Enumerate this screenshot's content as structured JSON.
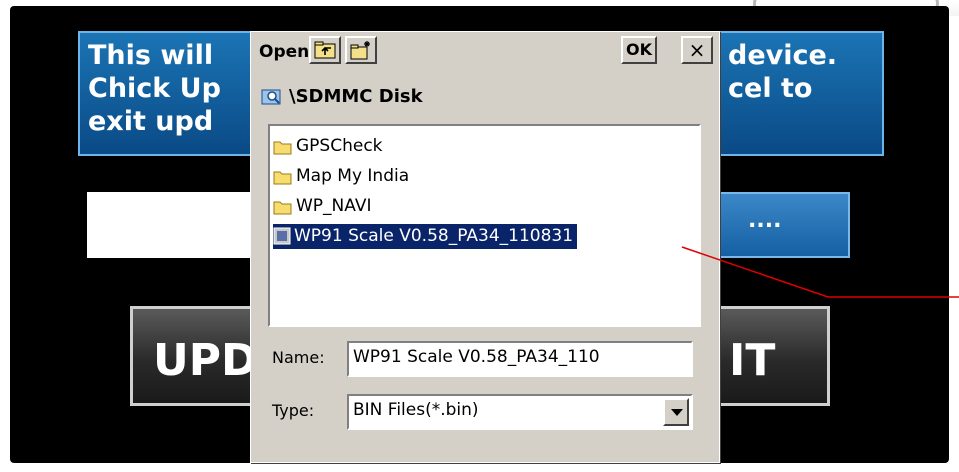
{
  "background_app": {
    "info_line1_left": "This will",
    "info_line1_right": "device.",
    "info_line2_left": "Chick Up",
    "info_line2_right": "cel to",
    "info_line3_left": "exit upd",
    "browse_label": "....",
    "update_label": "UPD/",
    "exit_label": "IT"
  },
  "dialog": {
    "title": "Open",
    "ok_label": "OK",
    "close_label": "×",
    "current_folder": "\\SDMMC Disk",
    "items": [
      {
        "label": "GPSCheck",
        "icon": "folder-icon",
        "selected": false
      },
      {
        "label": "Map My India",
        "icon": "folder-icon",
        "selected": false
      },
      {
        "label": "WP_NAVI",
        "icon": "folder-icon",
        "selected": false
      },
      {
        "label": "WP91 Scale V0.58_PA34_110831",
        "icon": "file-icon",
        "selected": true
      }
    ],
    "name_label": "Name:",
    "name_value": "WP91 Scale V0.58_PA34_110",
    "type_label": "Type:",
    "type_value": "BIN Files(*.bin)"
  },
  "colors": {
    "selection": "#0a246a",
    "dialog_face": "#d4d0c8",
    "panel_blue": "#1b74b4",
    "pointer_line": "#e00000"
  }
}
